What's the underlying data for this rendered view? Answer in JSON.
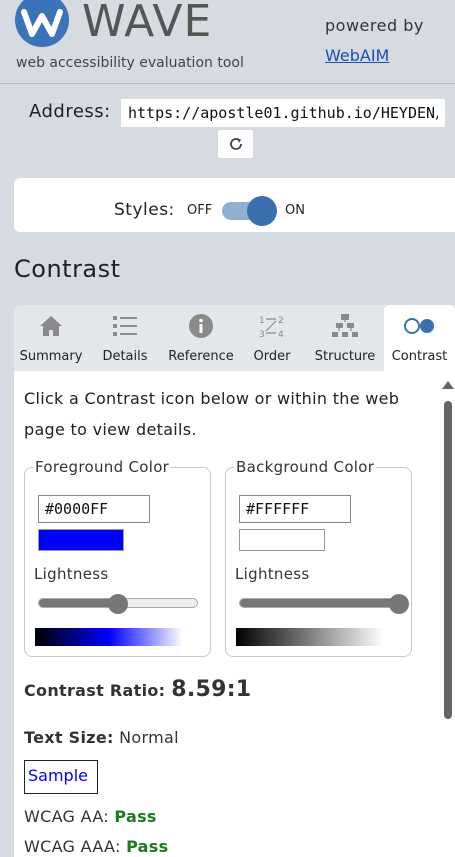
{
  "header": {
    "logo_text": "WAVE",
    "tagline": "web accessibility evaluation tool",
    "powered_by": "powered by",
    "webaim_link": "WebAIM"
  },
  "address": {
    "label": "Address:",
    "value": "https://apostle01.github.io/HEYDEN/"
  },
  "styles": {
    "label": "Styles:",
    "off_label": "OFF",
    "on_label": "ON",
    "state": "on"
  },
  "section_title": "Contrast",
  "tabs": [
    {
      "label": "Summary",
      "icon": "home-icon"
    },
    {
      "label": "Details",
      "icon": "list-icon"
    },
    {
      "label": "Reference",
      "icon": "info-icon"
    },
    {
      "label": "Order",
      "icon": "order-icon"
    },
    {
      "label": "Structure",
      "icon": "structure-icon"
    },
    {
      "label": "Contrast",
      "icon": "contrast-icon",
      "active": true
    }
  ],
  "contrast": {
    "instructions": "Click a Contrast icon below or within the web page to view details.",
    "foreground": {
      "legend": "Foreground Color",
      "hex": "#0000FF",
      "lightness_label": "Lightness",
      "lightness": 0.5
    },
    "background": {
      "legend": "Background Color",
      "hex": "#FFFFFF",
      "lightness_label": "Lightness",
      "lightness": 1.0
    },
    "ratio_label": "Contrast Ratio:",
    "ratio_value": "8.59:1",
    "text_size_label": "Text Size:",
    "text_size_value": "Normal",
    "sample_text": "Sample",
    "wcag_aa_label": "WCAG AA:",
    "wcag_aa_value": "Pass",
    "wcag_aaa_label": "WCAG AAA:",
    "wcag_aaa_value": "Pass"
  },
  "colors": {
    "brand_blue": "#3a6fb0",
    "link": "#1a4fb8",
    "pass": "#1e7a1e"
  }
}
